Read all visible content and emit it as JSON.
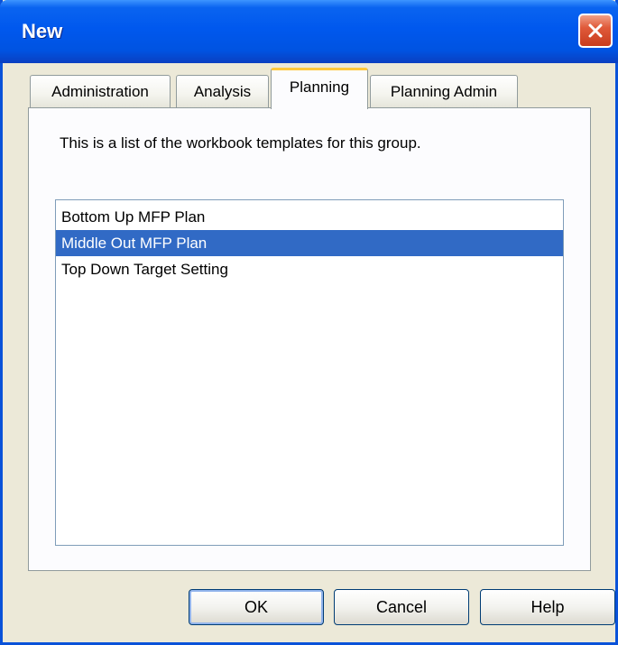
{
  "window": {
    "title": "New"
  },
  "tabs": [
    {
      "label": "Administration",
      "active": false
    },
    {
      "label": "Analysis",
      "active": false
    },
    {
      "label": "Planning",
      "active": true
    },
    {
      "label": "Planning Admin",
      "active": false
    }
  ],
  "panel": {
    "description": "This is a list of the workbook templates for this group.",
    "templates": [
      {
        "label": "Bottom Up MFP Plan",
        "selected": false
      },
      {
        "label": "Middle Out MFP Plan",
        "selected": true
      },
      {
        "label": "Top Down Target Setting",
        "selected": false
      }
    ]
  },
  "buttons": {
    "ok": "OK",
    "cancel": "Cancel",
    "help": "Help"
  },
  "colors": {
    "titlebar": "#0058ee",
    "selection": "#316ac5",
    "active_tab_accent": "#ffc83c",
    "close_button": "#e05a3a"
  }
}
